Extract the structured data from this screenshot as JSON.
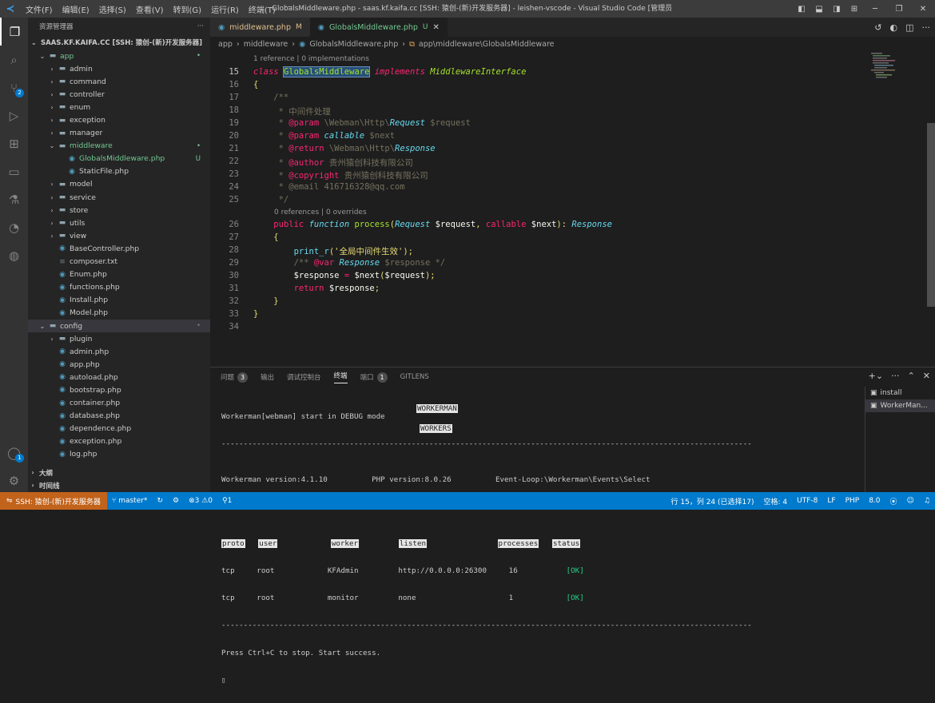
{
  "window": {
    "title": "GlobalsMiddleware.php - saas.kf.kaifa.cc [SSH: 猿创-(新)开发服务器] - leishen-vscode - Visual Studio Code [管理员]",
    "menu": [
      "文件(F)",
      "编辑(E)",
      "选择(S)",
      "查看(V)",
      "转到(G)",
      "运行(R)",
      "终端(T)",
      "···"
    ]
  },
  "activity": {
    "scm_badge": "2",
    "account_badge": "1"
  },
  "sidebar": {
    "header": "资源管理器",
    "more": "···",
    "project": "SAAS.KF.KAIFA.CC [SSH: 猿创-(新)开发服务器]",
    "outline": "大纲",
    "timeline": "时间线"
  },
  "tree": [
    {
      "label": "app",
      "type": "folder-open",
      "depth": 0,
      "color": "green",
      "status": "•"
    },
    {
      "label": "admin",
      "type": "folder",
      "depth": 1
    },
    {
      "label": "command",
      "type": "folder",
      "depth": 1
    },
    {
      "label": "controller",
      "type": "folder",
      "depth": 1
    },
    {
      "label": "enum",
      "type": "folder",
      "depth": 1
    },
    {
      "label": "exception",
      "type": "folder",
      "depth": 1
    },
    {
      "label": "manager",
      "type": "folder",
      "depth": 1
    },
    {
      "label": "middleware",
      "type": "folder-open",
      "depth": 1,
      "color": "green",
      "status": "•"
    },
    {
      "label": "GlobalsMiddleware.php",
      "type": "php",
      "depth": 2,
      "color": "green",
      "status": "U"
    },
    {
      "label": "StaticFile.php",
      "type": "php",
      "depth": 2
    },
    {
      "label": "model",
      "type": "folder",
      "depth": 1
    },
    {
      "label": "service",
      "type": "folder",
      "depth": 1
    },
    {
      "label": "store",
      "type": "folder",
      "depth": 1
    },
    {
      "label": "utils",
      "type": "folder",
      "depth": 1
    },
    {
      "label": "view",
      "type": "folder",
      "depth": 1
    },
    {
      "label": "BaseController.php",
      "type": "php",
      "depth": 1
    },
    {
      "label": "composer.txt",
      "type": "txt",
      "depth": 1
    },
    {
      "label": "Enum.php",
      "type": "php",
      "depth": 1
    },
    {
      "label": "functions.php",
      "type": "php",
      "depth": 1
    },
    {
      "label": "Install.php",
      "type": "php",
      "depth": 1
    },
    {
      "label": "Model.php",
      "type": "php",
      "depth": 1
    },
    {
      "label": "config",
      "type": "folder-open",
      "depth": 0,
      "status": "•",
      "selected": true
    },
    {
      "label": "plugin",
      "type": "folder",
      "depth": 1
    },
    {
      "label": "admin.php",
      "type": "php",
      "depth": 1
    },
    {
      "label": "app.php",
      "type": "php",
      "depth": 1
    },
    {
      "label": "autoload.php",
      "type": "php",
      "depth": 1
    },
    {
      "label": "bootstrap.php",
      "type": "php",
      "depth": 1
    },
    {
      "label": "container.php",
      "type": "php",
      "depth": 1
    },
    {
      "label": "database.php",
      "type": "php",
      "depth": 1
    },
    {
      "label": "dependence.php",
      "type": "php",
      "depth": 1
    },
    {
      "label": "exception.php",
      "type": "php",
      "depth": 1
    },
    {
      "label": "log.php",
      "type": "php",
      "depth": 1
    }
  ],
  "tabs": [
    {
      "label": "middleware.php",
      "status": "M"
    },
    {
      "label": "GlobalsMiddleware.php",
      "status": "U"
    }
  ],
  "breadcrumb": [
    "app",
    "middleware",
    "GlobalsMiddleware.php",
    "app\\middleware\\GlobalsMiddleware"
  ],
  "editor": {
    "lens1": "1 reference | 0 implementations",
    "lens2": "0 references | 0 overrides",
    "current_line": 15
  },
  "panel": {
    "tabs": [
      "问题",
      "输出",
      "调试控制台",
      "终端",
      "端口",
      "GITLENS"
    ],
    "problems_count": "3",
    "ports_count": "1",
    "terminals": [
      "install",
      "WorkerMan..."
    ]
  },
  "terminal": {
    "line1": "Workerman[webman] start in DEBUG mode",
    "section1": "WORKERMAN",
    "version_line": "Workerman version:4.1.10          PHP version:8.0.26          Event-Loop:\\Workerman\\Events\\Select",
    "section2": "WORKERS",
    "headers": [
      "proto",
      "user",
      "worker",
      "listen",
      "processes",
      "status"
    ],
    "rows": [
      [
        "tcp",
        "root",
        "KFAdmin",
        "http://0.0.0.0:26300",
        "16",
        "[OK]"
      ],
      [
        "tcp",
        "root",
        "monitor",
        "none",
        "1",
        "[OK]"
      ]
    ],
    "footer": "Press Ctrl+C to stop. Start success."
  },
  "status": {
    "remote": "SSH: 猿创-(新)开发服务器",
    "branch": "master*",
    "errors": "3",
    "warnings": "0",
    "ports": "1",
    "position": "行 15，列 24 (已选择17)",
    "spaces": "空格: 4",
    "encoding": "UTF-8",
    "eol": "LF",
    "language": "PHP",
    "version": "8.0"
  }
}
